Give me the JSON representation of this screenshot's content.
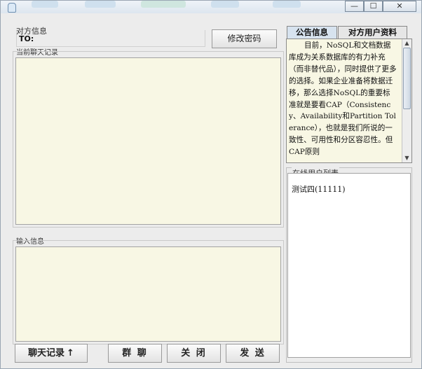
{
  "window": {
    "minimize_icon": "minimize-icon",
    "maximize_icon": "maximize-icon",
    "close_icon": "close-icon",
    "minimize_glyph": "—",
    "maximize_glyph": "☐",
    "close_glyph": "✕"
  },
  "contact": {
    "label": "对方信息",
    "to_label": "TO:",
    "to_value": ""
  },
  "change_password_button": "修改密码",
  "chat_history": {
    "label": "当前聊天记录",
    "content": ""
  },
  "input": {
    "label": "输入信息",
    "value": ""
  },
  "buttons": {
    "history": "聊天记录",
    "history_icon": "arrow-up-icon",
    "history_glyph": "↑",
    "group_chat": "群 聊",
    "close": "关 闭",
    "send": "发 送"
  },
  "tabs": [
    {
      "label": "公告信息",
      "active": true
    },
    {
      "label": "对方用户资料",
      "active": false
    }
  ],
  "notice": {
    "text": "目前，NoSQL和文档数据库成为关系数据库的有力补充（而非替代品），同时提供了更多的选择。如果企业准备将数据迁移，那么选择NoSQL的重要标准就是要看CAP（Consistency、Availability和Partition Tolerance），也就是我们所说的一致性、可用性和分区容忍性。但CAP原则"
  },
  "online_users": {
    "label": "在线用户列表",
    "items": [
      "测试四(11111)"
    ]
  },
  "colors": {
    "text_area_bg": "#f8f7e4",
    "active_tab_bg": "#d7e3ef"
  }
}
